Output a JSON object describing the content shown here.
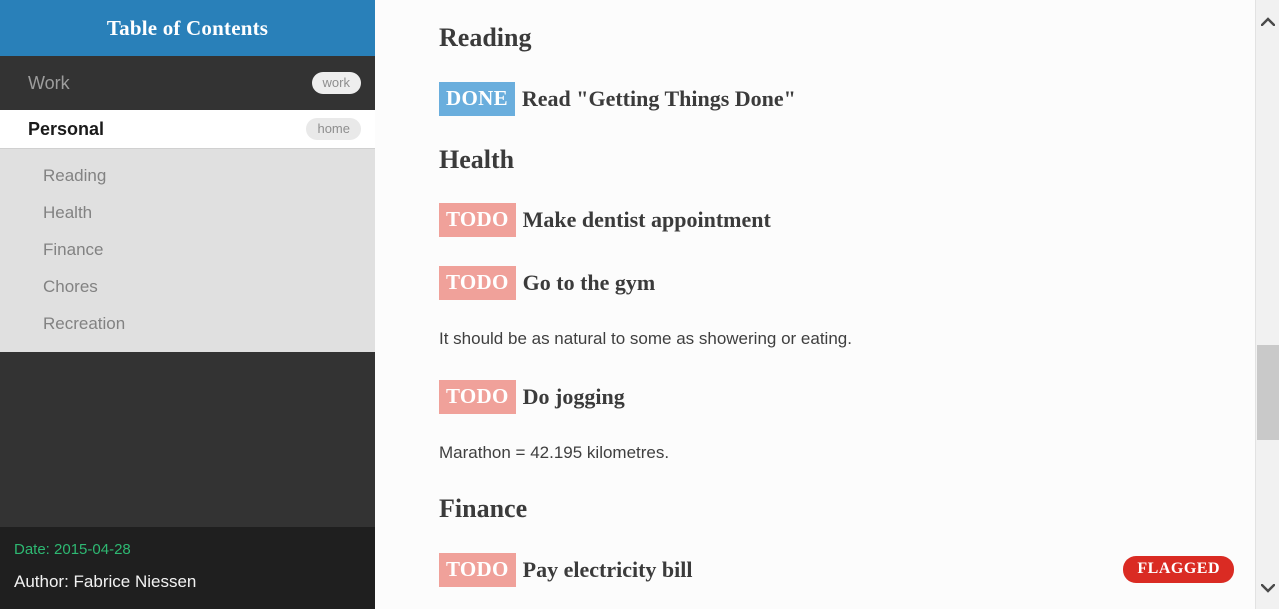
{
  "sidebar": {
    "header": {
      "title": "Table of Contents"
    },
    "top_items": [
      {
        "label": "Work",
        "tag": "work",
        "active": false
      },
      {
        "label": "Personal",
        "tag": "home",
        "active": true
      }
    ],
    "sub_items": [
      {
        "label": "Reading"
      },
      {
        "label": "Health"
      },
      {
        "label": "Finance"
      },
      {
        "label": "Chores"
      },
      {
        "label": "Recreation"
      }
    ],
    "footer": {
      "date": "Date: 2015-04-28",
      "author": "Author: Fabrice Niessen"
    }
  },
  "content": {
    "blocks": [
      {
        "kind": "heading",
        "text": "Reading"
      },
      {
        "kind": "task",
        "keyword": "DONE",
        "state": "done",
        "title": "Read \"Getting Things Done\"",
        "flag": ""
      },
      {
        "kind": "heading",
        "text": "Health"
      },
      {
        "kind": "task",
        "keyword": "TODO",
        "state": "todo",
        "title": "Make dentist appointment",
        "flag": ""
      },
      {
        "kind": "task",
        "keyword": "TODO",
        "state": "todo",
        "title": "Go to the gym",
        "flag": ""
      },
      {
        "kind": "paragraph",
        "text": "It should be as natural to some as showering or eating."
      },
      {
        "kind": "task",
        "keyword": "TODO",
        "state": "todo",
        "title": "Do jogging",
        "flag": ""
      },
      {
        "kind": "paragraph",
        "text": "Marathon = 42.195 kilometres."
      },
      {
        "kind": "heading",
        "text": "Finance"
      },
      {
        "kind": "task",
        "keyword": "TODO",
        "state": "todo",
        "title": "Pay electricity bill",
        "flag": "FLAGGED"
      }
    ]
  },
  "scrollbar": {
    "up_icon": "chevron-up-icon",
    "down_icon": "chevron-down-icon"
  },
  "colors": {
    "header_blue": "#2980b9",
    "sidebar_dark": "#333333",
    "sidebar_footer": "#1f1f1f",
    "sublist_gray": "#e0e0e0",
    "todo_badge": "#f0a19a",
    "done_badge": "#6aaedd",
    "flagged_badge": "#da2b23",
    "date_green": "#2eb872"
  }
}
